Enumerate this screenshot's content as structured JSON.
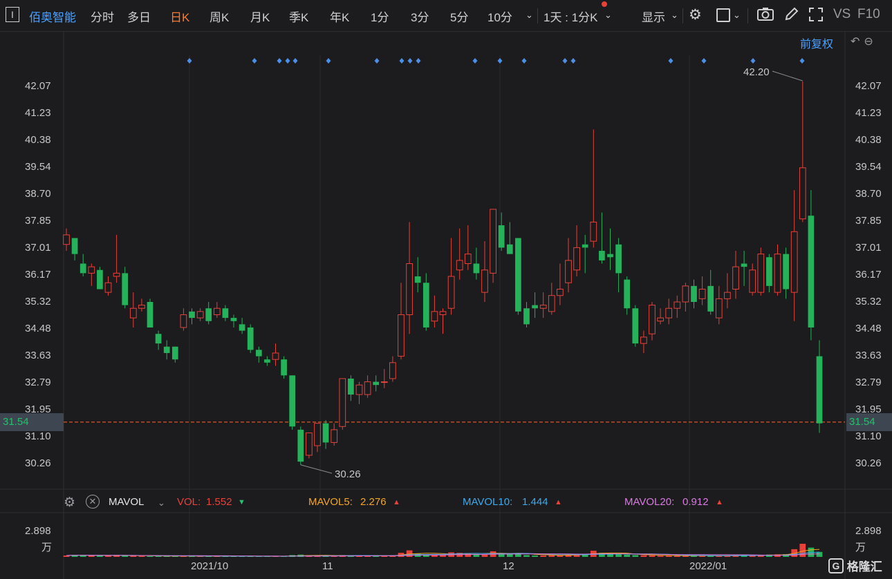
{
  "toolbar": {
    "menu_glyph": "I",
    "stock_name": "佰奥智能",
    "tabs": [
      "分时",
      "多日",
      "日K",
      "周K",
      "月K",
      "季K",
      "年K",
      "1分",
      "3分",
      "5分",
      "10分"
    ],
    "active_tab": "日K",
    "period_select": "1天 : 1分K",
    "display_label": "显示",
    "vs_label": "VS",
    "f10_label": "F10",
    "colors": {
      "active": "#ff7a2f",
      "stock": "#4aa0ff"
    }
  },
  "price_panel": {
    "adjust_label": "前复权",
    "y_ticks": [
      "42.07",
      "41.23",
      "40.38",
      "39.54",
      "38.70",
      "37.85",
      "37.01",
      "36.17",
      "35.32",
      "34.48",
      "33.63",
      "32.79",
      "31.95",
      "31.10",
      "30.26"
    ],
    "current_price": "31.54",
    "high_annotation": "42.20",
    "low_annotation": "30.26",
    "date_labels": [
      "2021/10",
      "11",
      "12",
      "2022/01"
    ]
  },
  "volume_panel": {
    "indicator": "MAVOL",
    "vol_label": "VOL:",
    "vol_value": "1.552",
    "mavol5_label": "MAVOL5:",
    "mavol5_value": "2.276",
    "mavol10_label": "MAVOL10:",
    "mavol10_value": "1.444",
    "mavol20_label": "MAVOL20:",
    "mavol20_value": "0.912",
    "y_tick": "2.898",
    "unit": "万",
    "colors": {
      "vol": "#e8413a",
      "mavol5": "#f5a623",
      "mavol10": "#3aaaf0",
      "mavol20": "#d87ae0"
    }
  },
  "watermark": "格隆汇",
  "chart_data": {
    "type": "candlestick",
    "ylim": [
      30.26,
      42.07
    ],
    "candles": [
      [
        37.1,
        37.4,
        37.6,
        36.9
      ],
      [
        37.3,
        36.8,
        37.3,
        36.6
      ],
      [
        36.5,
        36.2,
        36.8,
        36.1
      ],
      [
        36.2,
        36.4,
        36.5,
        35.8
      ],
      [
        36.3,
        35.7,
        36.4,
        35.7
      ],
      [
        35.6,
        35.9,
        36.1,
        35.5
      ],
      [
        36.1,
        36.2,
        37.4,
        35.9
      ],
      [
        36.2,
        35.2,
        36.4,
        35.1
      ],
      [
        34.8,
        35.1,
        35.6,
        34.5
      ],
      [
        35.1,
        35.2,
        35.4,
        35.0
      ],
      [
        35.3,
        34.5,
        35.4,
        34.5
      ],
      [
        34.3,
        34.0,
        34.4,
        33.8
      ],
      [
        33.9,
        33.7,
        34.1,
        33.5
      ],
      [
        33.9,
        33.5,
        33.9,
        33.4
      ],
      [
        34.5,
        34.9,
        35.1,
        34.4
      ],
      [
        35.0,
        34.8,
        35.1,
        34.6
      ],
      [
        34.8,
        35.0,
        35.1,
        34.7
      ],
      [
        35.1,
        34.7,
        35.3,
        34.6
      ],
      [
        34.9,
        35.1,
        35.3,
        34.8
      ],
      [
        35.1,
        34.8,
        35.2,
        34.7
      ],
      [
        34.8,
        34.7,
        34.9,
        34.5
      ],
      [
        34.6,
        34.4,
        34.8,
        34.3
      ],
      [
        34.5,
        33.8,
        34.6,
        33.7
      ],
      [
        33.8,
        33.6,
        33.9,
        33.4
      ],
      [
        33.5,
        33.4,
        33.6,
        33.3
      ],
      [
        33.5,
        33.7,
        34.0,
        33.3
      ],
      [
        33.5,
        33.0,
        33.6,
        32.9
      ],
      [
        33.0,
        31.4,
        33.0,
        31.3
      ],
      [
        31.3,
        30.3,
        31.4,
        30.2
      ],
      [
        30.5,
        31.2,
        31.2,
        30.4
      ],
      [
        30.8,
        31.5,
        31.5,
        30.6
      ],
      [
        31.5,
        30.9,
        31.6,
        30.7
      ],
      [
        30.9,
        31.3,
        31.5,
        30.8
      ],
      [
        31.4,
        32.9,
        32.9,
        31.3
      ],
      [
        32.9,
        32.4,
        33.0,
        32.2
      ],
      [
        32.4,
        32.7,
        32.8,
        32.1
      ],
      [
        32.4,
        32.8,
        33.0,
        32.3
      ],
      [
        32.8,
        32.7,
        33.0,
        32.5
      ],
      [
        32.8,
        32.8,
        33.2,
        32.6
      ],
      [
        32.9,
        33.4,
        33.6,
        32.8
      ],
      [
        33.6,
        34.9,
        35.9,
        33.5
      ],
      [
        34.9,
        36.5,
        37.8,
        34.3
      ],
      [
        36.1,
        35.9,
        36.7,
        35.6
      ],
      [
        35.9,
        34.5,
        36.2,
        34.4
      ],
      [
        34.7,
        35.0,
        35.5,
        34.5
      ],
      [
        34.9,
        35.0,
        35.1,
        34.3
      ],
      [
        35.1,
        36.1,
        37.3,
        34.9
      ],
      [
        36.3,
        36.6,
        37.6,
        36.0
      ],
      [
        36.5,
        36.8,
        37.7,
        36.3
      ],
      [
        36.5,
        36.2,
        37.0,
        36.0
      ],
      [
        35.6,
        36.3,
        37.2,
        35.3
      ],
      [
        36.2,
        38.2,
        38.2,
        35.9
      ],
      [
        37.7,
        37.0,
        38.1,
        36.9
      ],
      [
        37.1,
        36.8,
        37.8,
        36.8
      ],
      [
        37.3,
        35.0,
        37.3,
        34.9
      ],
      [
        35.1,
        34.6,
        35.3,
        34.5
      ],
      [
        35.2,
        35.1,
        35.6,
        34.8
      ],
      [
        35.1,
        35.2,
        35.6,
        34.8
      ],
      [
        35.0,
        35.5,
        35.9,
        34.9
      ],
      [
        35.5,
        35.7,
        36.5,
        35.2
      ],
      [
        35.9,
        36.6,
        37.3,
        35.6
      ],
      [
        36.3,
        37.0,
        37.7,
        36.1
      ],
      [
        37.1,
        37.0,
        37.4,
        36.2
      ],
      [
        37.2,
        37.8,
        40.7,
        37.0
      ],
      [
        36.9,
        36.6,
        38.1,
        36.5
      ],
      [
        36.8,
        36.7,
        37.6,
        36.3
      ],
      [
        37.1,
        36.2,
        37.3,
        35.6
      ],
      [
        36.0,
        35.1,
        36.1,
        34.9
      ],
      [
        35.1,
        34.0,
        35.2,
        33.9
      ],
      [
        34.0,
        34.2,
        34.4,
        33.7
      ],
      [
        34.3,
        35.2,
        35.3,
        34.1
      ],
      [
        34.7,
        34.8,
        35.1,
        34.6
      ],
      [
        34.8,
        35.1,
        35.4,
        34.6
      ],
      [
        35.1,
        35.3,
        35.5,
        34.8
      ],
      [
        35.3,
        35.8,
        35.9,
        35.0
      ],
      [
        35.8,
        35.3,
        36.0,
        35.1
      ],
      [
        35.4,
        35.7,
        36.1,
        35.2
      ],
      [
        35.8,
        35.0,
        36.3,
        34.9
      ],
      [
        34.8,
        35.4,
        35.8,
        34.6
      ],
      [
        35.4,
        35.6,
        36.2,
        35.1
      ],
      [
        35.7,
        36.4,
        36.9,
        35.4
      ],
      [
        36.5,
        36.4,
        36.9,
        35.8
      ],
      [
        35.6,
        36.3,
        36.5,
        35.5
      ],
      [
        35.6,
        36.8,
        37.0,
        35.5
      ],
      [
        36.7,
        35.8,
        36.8,
        35.6
      ],
      [
        35.6,
        36.8,
        37.1,
        35.5
      ],
      [
        36.8,
        35.7,
        37.0,
        35.4
      ],
      [
        35.6,
        37.5,
        38.8,
        34.7
      ],
      [
        37.9,
        39.5,
        42.2,
        37.8
      ],
      [
        38.0,
        34.5,
        38.8,
        34.1
      ],
      [
        33.6,
        31.5,
        34.1,
        31.2
      ]
    ],
    "volume": [
      0.15,
      0.22,
      0.18,
      0.16,
      0.14,
      0.12,
      0.21,
      0.15,
      0.12,
      0.11,
      0.09,
      0.1,
      0.08,
      0.09,
      0.1,
      0.08,
      0.07,
      0.09,
      0.08,
      0.07,
      0.08,
      0.06,
      0.09,
      0.07,
      0.06,
      0.07,
      0.08,
      0.2,
      0.25,
      0.15,
      0.12,
      0.14,
      0.1,
      0.2,
      0.15,
      0.13,
      0.12,
      0.11,
      0.14,
      0.18,
      0.45,
      0.72,
      0.35,
      0.28,
      0.24,
      0.2,
      0.5,
      0.45,
      0.42,
      0.3,
      0.25,
      0.62,
      0.38,
      0.3,
      0.42,
      0.2,
      0.15,
      0.16,
      0.18,
      0.2,
      0.25,
      0.3,
      0.32,
      0.68,
      0.45,
      0.38,
      0.3,
      0.25,
      0.2,
      0.18,
      0.16,
      0.12,
      0.14,
      0.13,
      0.15,
      0.14,
      0.13,
      0.12,
      0.14,
      0.15,
      0.2,
      0.18,
      0.15,
      0.22,
      0.25,
      0.28,
      0.3,
      0.85,
      1.45,
      1.02,
      0.55
    ],
    "volume_ylim": [
      0,
      2.898
    ]
  }
}
